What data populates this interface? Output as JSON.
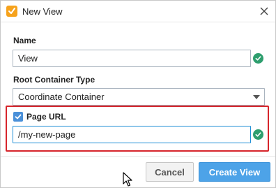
{
  "window": {
    "title": "New View",
    "icon": "app-logo-icon",
    "close_icon": "close-icon"
  },
  "form": {
    "name_label": "Name",
    "name_value": "View",
    "root_container_label": "Root Container Type",
    "root_container_value": "Coordinate Container",
    "page_url_label": "Page URL",
    "page_url_checked": true,
    "page_url_value": "/my-new-page"
  },
  "buttons": {
    "cancel_label": "Cancel",
    "create_label": "Create View"
  },
  "colors": {
    "accent": "#4da3e8",
    "valid": "#2e9e6e",
    "highlight": "#d7252b",
    "app_icon": "#f6a21c"
  }
}
